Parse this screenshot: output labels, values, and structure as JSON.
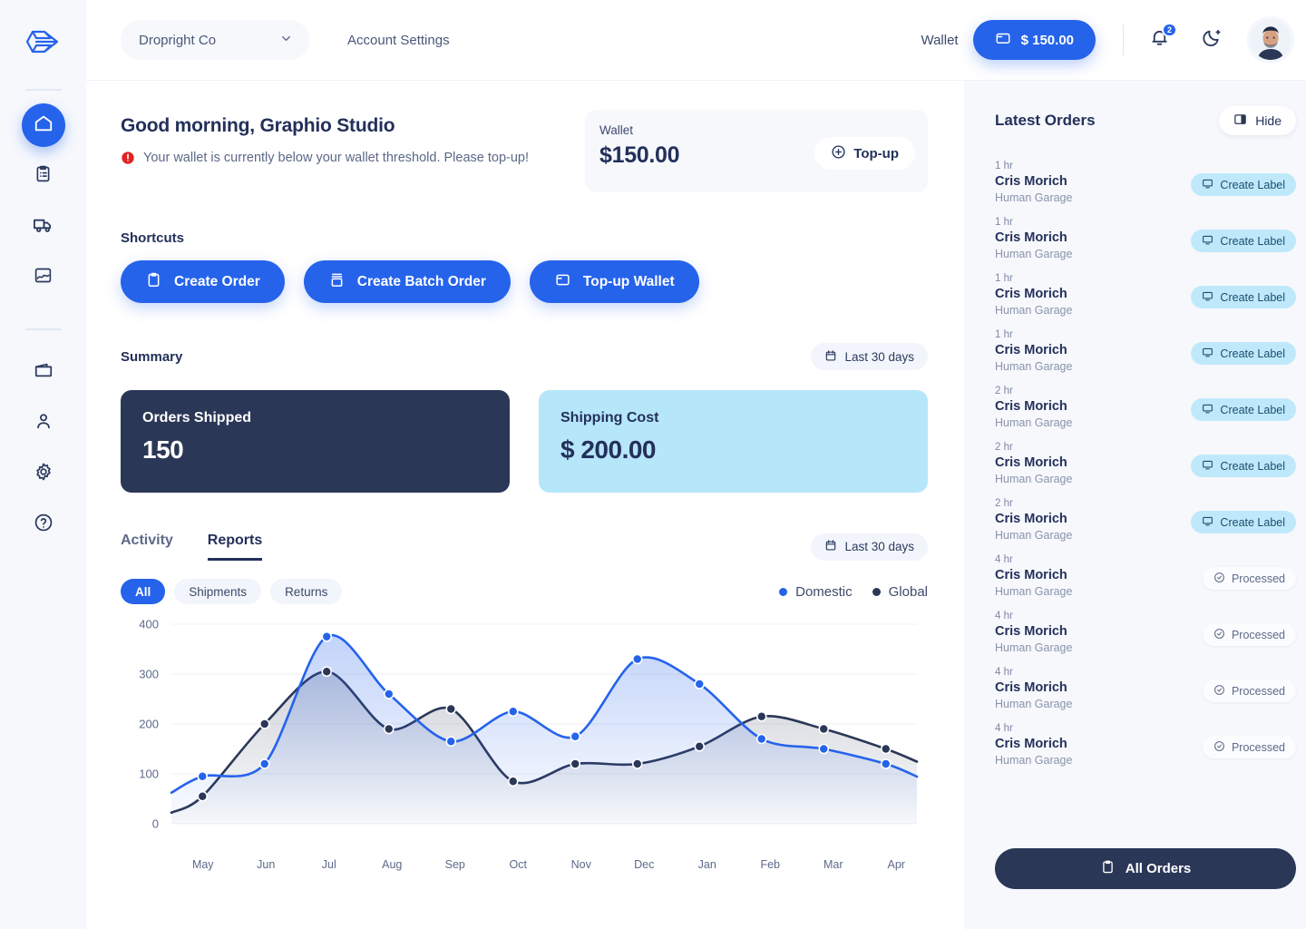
{
  "sidebar": {
    "logo_icon": "droplet-arrow-logo",
    "items": [
      {
        "icon": "home-icon",
        "name": "home",
        "active": true
      },
      {
        "icon": "clipboard-icon",
        "name": "orders",
        "active": false
      },
      {
        "icon": "truck-icon",
        "name": "shipments",
        "active": false
      },
      {
        "icon": "image-chart-icon",
        "name": "reports",
        "active": false
      },
      {
        "icon": "wallet-icon",
        "name": "wallet",
        "active": false
      },
      {
        "icon": "user-icon",
        "name": "account",
        "active": false
      },
      {
        "icon": "gear-icon",
        "name": "settings",
        "active": false
      },
      {
        "icon": "help-circle-icon",
        "name": "help",
        "active": false
      }
    ]
  },
  "header": {
    "org_name": "Dropright Co",
    "account_settings": "Account Settings",
    "wallet_label": "Wallet",
    "wallet_amount": "$ 150.00",
    "notification_count": "2",
    "notification_icon": "bell-icon",
    "theme_icon": "moon-icon",
    "chevron_icon": "chevron-down-icon",
    "wallet_icon": "wallet-icon"
  },
  "greeting": {
    "title": "Good morning, Graphio Studio",
    "alert_icon": "alert-circle-icon",
    "alert_text": "Your wallet is currently below your wallet threshold. Please top-up!"
  },
  "wallet_card": {
    "label": "Wallet",
    "amount": "$150.00",
    "topup_label": "Top-up",
    "topup_icon": "plus-circle-icon"
  },
  "shortcuts": {
    "title": "Shortcuts",
    "buttons": [
      {
        "label": "Create Order",
        "icon": "clipboard-icon"
      },
      {
        "label": "Create Batch Order",
        "icon": "box-stack-icon"
      },
      {
        "label": "Top-up Wallet",
        "icon": "wallet-icon"
      }
    ]
  },
  "summary": {
    "title": "Summary",
    "range_label": "Last 30 days",
    "range_icon": "calendar-icon",
    "cards": [
      {
        "title": "Orders Shipped",
        "value": "150",
        "style": "dark"
      },
      {
        "title": "Shipping Cost",
        "value": "$ 200.00",
        "style": "light"
      }
    ]
  },
  "reports": {
    "tabs": [
      {
        "label": "Activity",
        "active": false
      },
      {
        "label": "Reports",
        "active": true
      }
    ],
    "range_label": "Last 30 days",
    "range_icon": "calendar-icon",
    "filters": [
      {
        "label": "All",
        "active": true
      },
      {
        "label": "Shipments",
        "active": false
      },
      {
        "label": "Returns",
        "active": false
      }
    ]
  },
  "chart_data": {
    "type": "line",
    "title": "",
    "xlabel": "",
    "ylabel": "",
    "ylim": [
      0,
      400
    ],
    "yticks": [
      0,
      100,
      200,
      300,
      400
    ],
    "grid": true,
    "legend_position": "top-right",
    "categories": [
      "May",
      "Jun",
      "Jul",
      "Aug",
      "Sep",
      "Oct",
      "Nov",
      "Dec",
      "Jan",
      "Feb",
      "Mar",
      "Apr"
    ],
    "series": [
      {
        "name": "Domestic",
        "color": "#2563eb",
        "values": [
          95,
          120,
          375,
          260,
          165,
          225,
          175,
          330,
          280,
          170,
          150,
          120
        ]
      },
      {
        "name": "Global",
        "color": "#2b3757",
        "values": [
          55,
          200,
          305,
          190,
          230,
          85,
          120,
          120,
          155,
          215,
          190,
          150
        ]
      }
    ]
  },
  "latest_orders": {
    "title": "Latest Orders",
    "hide_label": "Hide",
    "hide_icon": "panel-collapse-icon",
    "all_orders_label": "All Orders",
    "all_orders_icon": "clipboard-icon",
    "items": [
      {
        "time": "1 hr",
        "name": "Cris Morich",
        "company": "Human Garage",
        "action": "Create Label",
        "action_type": "label",
        "icon": "printer-icon"
      },
      {
        "time": "1 hr",
        "name": "Cris Morich",
        "company": "Human Garage",
        "action": "Create Label",
        "action_type": "label",
        "icon": "printer-icon"
      },
      {
        "time": "1 hr",
        "name": "Cris Morich",
        "company": "Human Garage",
        "action": "Create Label",
        "action_type": "label",
        "icon": "printer-icon"
      },
      {
        "time": "1 hr",
        "name": "Cris Morich",
        "company": "Human Garage",
        "action": "Create Label",
        "action_type": "label",
        "icon": "printer-icon"
      },
      {
        "time": "2 hr",
        "name": "Cris Morich",
        "company": "Human Garage",
        "action": "Create Label",
        "action_type": "label",
        "icon": "printer-icon"
      },
      {
        "time": "2 hr",
        "name": "Cris Morich",
        "company": "Human Garage",
        "action": "Create Label",
        "action_type": "label",
        "icon": "printer-icon"
      },
      {
        "time": "2 hr",
        "name": "Cris Morich",
        "company": "Human Garage",
        "action": "Create Label",
        "action_type": "label",
        "icon": "printer-icon"
      },
      {
        "time": "4 hr",
        "name": "Cris Morich",
        "company": "Human Garage",
        "action": "Processed",
        "action_type": "status",
        "icon": "check-circle-icon"
      },
      {
        "time": "4 hr",
        "name": "Cris Morich",
        "company": "Human Garage",
        "action": "Processed",
        "action_type": "status",
        "icon": "check-circle-icon"
      },
      {
        "time": "4 hr",
        "name": "Cris Morich",
        "company": "Human Garage",
        "action": "Processed",
        "action_type": "status",
        "icon": "check-circle-icon"
      },
      {
        "time": "4 hr",
        "name": "Cris Morich",
        "company": "Human Garage",
        "action": "Processed",
        "action_type": "status",
        "icon": "check-circle-icon"
      }
    ]
  },
  "colors": {
    "accent": "#2563eb",
    "dark": "#2b3757",
    "light_cyan": "#b6e6fa",
    "panel_bg": "#f6f8fc",
    "alert_red": "#e02424"
  }
}
